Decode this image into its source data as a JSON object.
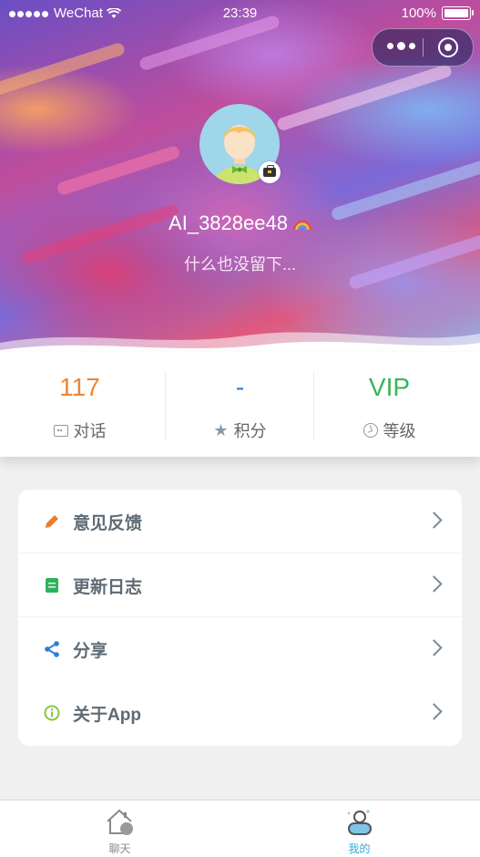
{
  "status_bar": {
    "carrier": "WeChat",
    "time": "23:39",
    "battery": "100%"
  },
  "profile": {
    "username": "AI_3828ee48",
    "bio": "什么也没留下..."
  },
  "stats": [
    {
      "value": "117",
      "label": "对话",
      "icon": "chat-icon",
      "color": "#ee8433"
    },
    {
      "value": "-",
      "label": "积分",
      "icon": "star-icon",
      "color": "#2a7fd4"
    },
    {
      "value": "VIP",
      "label": "等级",
      "icon": "level-icon",
      "color": "#3ab45a"
    }
  ],
  "menu": [
    {
      "label": "意见反馈",
      "icon": "pencil-icon",
      "icon_color": "#ee7a2e"
    },
    {
      "label": "更新日志",
      "icon": "notebook-icon",
      "icon_color": "#2fb35a"
    },
    {
      "label": "分享",
      "icon": "share-icon",
      "icon_color": "#2a7fd4"
    },
    {
      "label": "关于App",
      "icon": "info-icon",
      "icon_color": "#8cc63f"
    }
  ],
  "tabbar": {
    "items": [
      {
        "label": "聊天",
        "icon": "home-chat-icon",
        "active": false
      },
      {
        "label": "我的",
        "icon": "profile-icon",
        "active": true
      }
    ],
    "active_color": "#3aa7d9",
    "inactive_color": "#8a8a8a"
  }
}
